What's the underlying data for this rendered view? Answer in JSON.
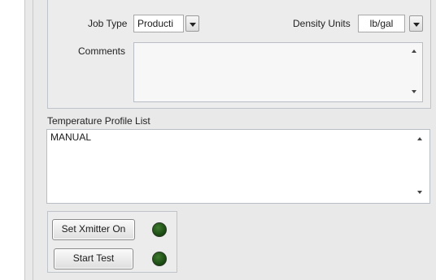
{
  "job": {
    "type_label": "Job Type",
    "type_value": "Producti",
    "density_label": "Density Units",
    "density_value": "lb/gal",
    "comments_label": "Comments",
    "comments_value": ""
  },
  "temperature": {
    "list_label": "Temperature Profile List",
    "list_value": "MANUAL"
  },
  "controls": {
    "xmitter_button": "Set Xmitter On",
    "start_button": "Start Test",
    "xmitter_led_color": "#1d4d14",
    "start_led_color": "#1d4d14"
  }
}
